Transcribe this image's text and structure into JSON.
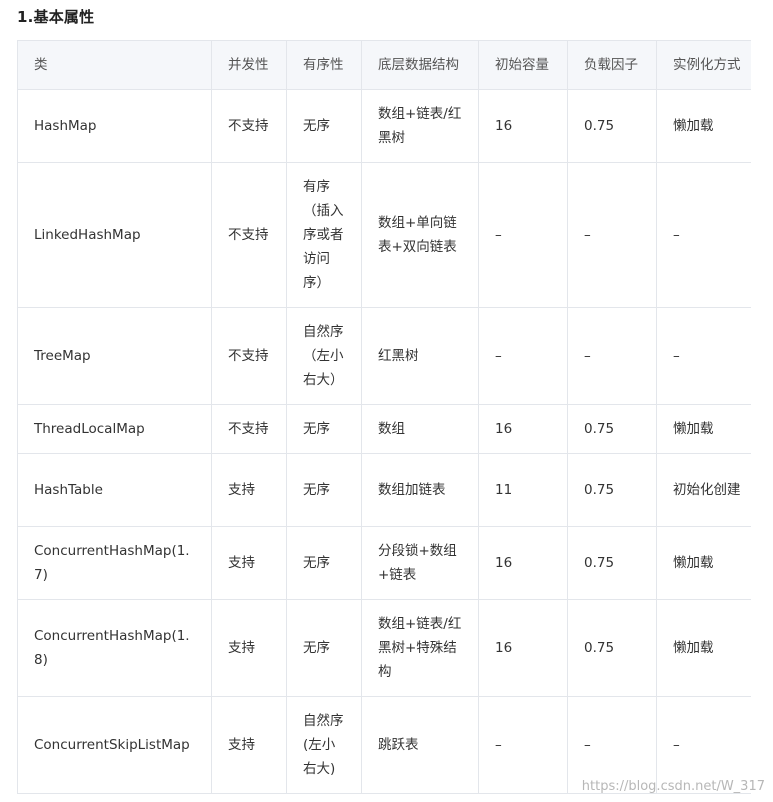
{
  "title": "1.基本属性",
  "table": {
    "headers": [
      "类",
      "并发性",
      "有序性",
      "底层数据结构",
      "初始容量",
      "负载因子",
      "实例化方式"
    ],
    "rows": [
      [
        "HashMap",
        "不支持",
        "无序",
        "数组+链表/红黑树",
        "16",
        "0.75",
        "懒加载"
      ],
      [
        "LinkedHashMap",
        "不支持",
        "有序（插入序或者访问序）",
        "数组+单向链表+双向链表",
        "–",
        "–",
        "–"
      ],
      [
        "TreeMap",
        "不支持",
        "自然序（左小右大）",
        "红黑树",
        "–",
        "–",
        "–"
      ],
      [
        "ThreadLocalMap",
        "不支持",
        "无序",
        "数组",
        "16",
        "0.75",
        "懒加载"
      ],
      [
        "HashTable",
        "支持",
        "无序",
        "数组加链表",
        "11",
        "0.75",
        "初始化创建"
      ],
      [
        "ConcurrentHashMap(1.7)",
        "支持",
        "无序",
        "分段锁+数组+链表",
        "16",
        "0.75",
        "懒加载"
      ],
      [
        "ConcurrentHashMap(1.8)",
        "支持",
        "无序",
        "数组+链表/红黑树+特殊结构",
        "16",
        "0.75",
        "懒加载"
      ],
      [
        "ConcurrentSkipListMap",
        "支持",
        "自然序(左小右大)",
        "跳跃表",
        "–",
        "–",
        "–"
      ]
    ],
    "row_heights": [
      73,
      145,
      97,
      49,
      73,
      73,
      97,
      97
    ]
  },
  "watermark": "https://blog.csdn.net/W_317"
}
